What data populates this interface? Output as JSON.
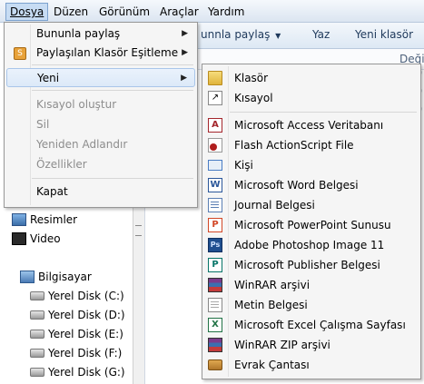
{
  "menubar": {
    "items": [
      {
        "label": "Dosya",
        "active": true
      },
      {
        "label": "Düzen"
      },
      {
        "label": "Görünüm"
      },
      {
        "label": "Araçlar"
      },
      {
        "label": "Yardım"
      }
    ]
  },
  "toolbar": {
    "share_label": "unnla paylaş",
    "share_full": "Bununla paylaş",
    "burn_label": "Yaz",
    "new_folder_label": "Yeni klasör"
  },
  "column_header": {
    "partial": "Değiş"
  },
  "file_menu": {
    "items": [
      {
        "label": "Bununla paylaş",
        "submenu": true
      },
      {
        "label": "Paylaşılan Klasör Eşitleme",
        "submenu": true
      },
      {
        "label": "Yeni",
        "submenu": true,
        "highlighted": true
      },
      {
        "label": "Kısayol oluştur",
        "disabled": true
      },
      {
        "label": "Sil",
        "disabled": true
      },
      {
        "label": "Yeniden Adlandır",
        "disabled": true
      },
      {
        "label": "Özellikler",
        "disabled": true
      },
      {
        "label": "Kapat"
      }
    ]
  },
  "new_menu": {
    "items": [
      {
        "label": "Klasör",
        "icon": "folder-icon",
        "color": "#e8c04a"
      },
      {
        "label": "Kısayol",
        "icon": "shortcut-icon",
        "color": "#ffffff"
      },
      {
        "label": "Microsoft Access Veritabanı",
        "icon": "access-icon",
        "color": "#a4262c"
      },
      {
        "label": "Flash ActionScript File",
        "icon": "flash-icon",
        "color": "#b01f1f"
      },
      {
        "label": "Kişi",
        "icon": "contact-icon",
        "color": "#4a7dc4"
      },
      {
        "label": "Microsoft Word Belgesi",
        "icon": "word-icon",
        "color": "#2b579a"
      },
      {
        "label": "Journal Belgesi",
        "icon": "journal-icon",
        "color": "#5b7fb3"
      },
      {
        "label": "Microsoft PowerPoint Sunusu",
        "icon": "powerpoint-icon",
        "color": "#d24726"
      },
      {
        "label": "Adobe Photoshop Image 11",
        "icon": "photoshop-icon",
        "color": "#1f4f8f"
      },
      {
        "label": "Microsoft Publisher Belgesi",
        "icon": "publisher-icon",
        "color": "#077568"
      },
      {
        "label": "WinRAR arşivi",
        "icon": "winrar-icon",
        "color": "#7a3b8c"
      },
      {
        "label": "Metin Belgesi",
        "icon": "text-document-icon",
        "color": "#ffffff"
      },
      {
        "label": "Microsoft Excel Çalışma Sayfası",
        "icon": "excel-icon",
        "color": "#217346"
      },
      {
        "label": "WinRAR ZIP arşivi",
        "icon": "winrar-zip-icon",
        "color": "#7a3b8c"
      },
      {
        "label": "Evrak Çantası",
        "icon": "briefcase-icon",
        "color": "#c98a2c"
      }
    ]
  },
  "nav": {
    "items": [
      {
        "label": "Resimler",
        "icon": "pictures-icon"
      },
      {
        "label": "Video",
        "icon": "video-icon"
      },
      {
        "label": "Bilgisayar",
        "icon": "computer-icon"
      },
      {
        "label": "Yerel Disk (C:)",
        "icon": "drive-icon"
      },
      {
        "label": "Yerel Disk (D:)",
        "icon": "drive-icon"
      },
      {
        "label": "Yerel Disk (E:)",
        "icon": "drive-icon"
      },
      {
        "label": "Yerel Disk (F:)",
        "icon": "drive-icon"
      },
      {
        "label": "Yerel Disk (G:)",
        "icon": "drive-icon"
      }
    ]
  }
}
